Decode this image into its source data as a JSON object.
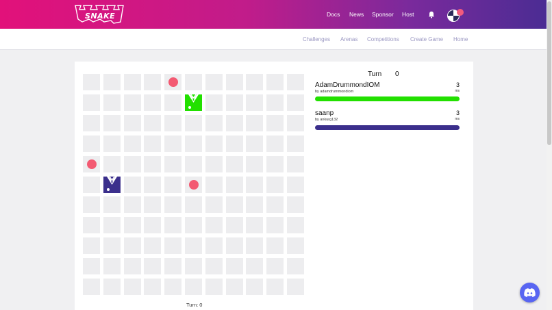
{
  "brand": {
    "logo_text": "SNAKE"
  },
  "nav": {
    "docs": "Docs",
    "news": "News",
    "sponsor": "Sponsor",
    "host": "Host"
  },
  "subnav": {
    "challenges": "Challenges",
    "arenas": "Arenas",
    "competitions": "Competitions",
    "create_game": "Create Game",
    "home": "Home"
  },
  "game": {
    "turn_label": "Turn",
    "turn_value": "0",
    "turn_footer": "Turn: 0",
    "board": {
      "columns": 11,
      "rows": 11
    },
    "food": [
      {
        "col": 4,
        "row": 0
      },
      {
        "col": 0,
        "row": 4
      },
      {
        "col": 5,
        "row": 5
      }
    ],
    "snakes": [
      {
        "col": 5,
        "row": 1,
        "color": "#22e000"
      },
      {
        "col": 1,
        "row": 5,
        "color": "#3b2f8c"
      }
    ]
  },
  "players": [
    {
      "name": "AdamDrummondIOM",
      "by": "by adamdrummondiom",
      "length": "3",
      "unit": "ms",
      "color": "#22e000",
      "health": 1.0
    },
    {
      "name": "saanp",
      "by": "by ankurg132",
      "length": "3",
      "unit": "ms",
      "color": "#3b2f8c",
      "health": 1.0
    }
  ],
  "colors": {
    "food": "#f35a72",
    "accent_pink": "#e2117a",
    "accent_purple": "#4b2c93",
    "discord": "#5865f2"
  },
  "icons": {
    "bell": "bell-icon",
    "discord": "discord-icon",
    "avatar": "avatar"
  }
}
